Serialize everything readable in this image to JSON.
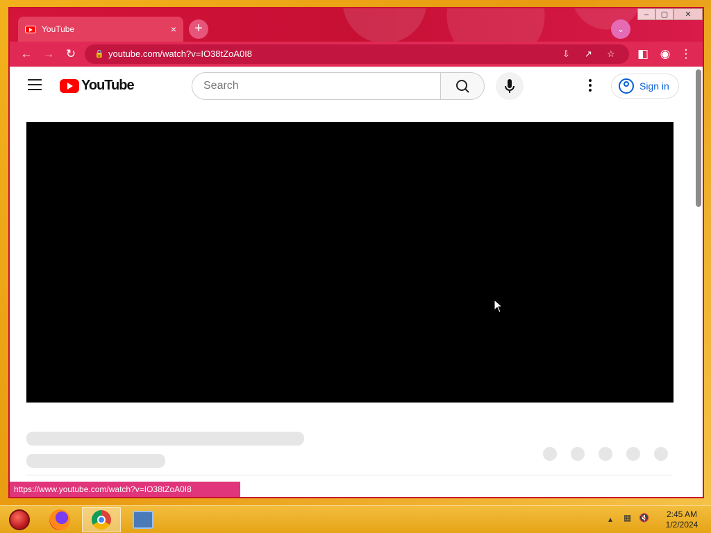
{
  "browser": {
    "tab": {
      "title": "YouTube",
      "close": "×"
    },
    "new_tab": "+",
    "window_controls": {
      "minimize": "–",
      "maximize": "▢",
      "close": "✕"
    },
    "address": "youtube.com/watch?v=IO38tZoA0I8",
    "status_url": "https://www.youtube.com/watch?v=IO38tZoA0I8"
  },
  "youtube": {
    "logo_text": "YouTube",
    "search_placeholder": "Search",
    "sign_in": "Sign in"
  },
  "taskbar": {
    "clock_time": "2:45 AM",
    "clock_date": "1/2/2024"
  },
  "colors": {
    "titlebar": "#c70f34",
    "toolbar": "#e02a55",
    "taskbar": "#f3bd3d",
    "link_blue": "#065fd4"
  },
  "icons": [
    "youtube-favicon",
    "back-icon",
    "forward-icon",
    "reload-icon",
    "lock-icon",
    "install-icon",
    "share-icon",
    "star-icon",
    "sidepanel-icon",
    "profile-icon",
    "more-icon",
    "hamburger-icon",
    "search-icon",
    "mic-icon",
    "user-icon"
  ]
}
